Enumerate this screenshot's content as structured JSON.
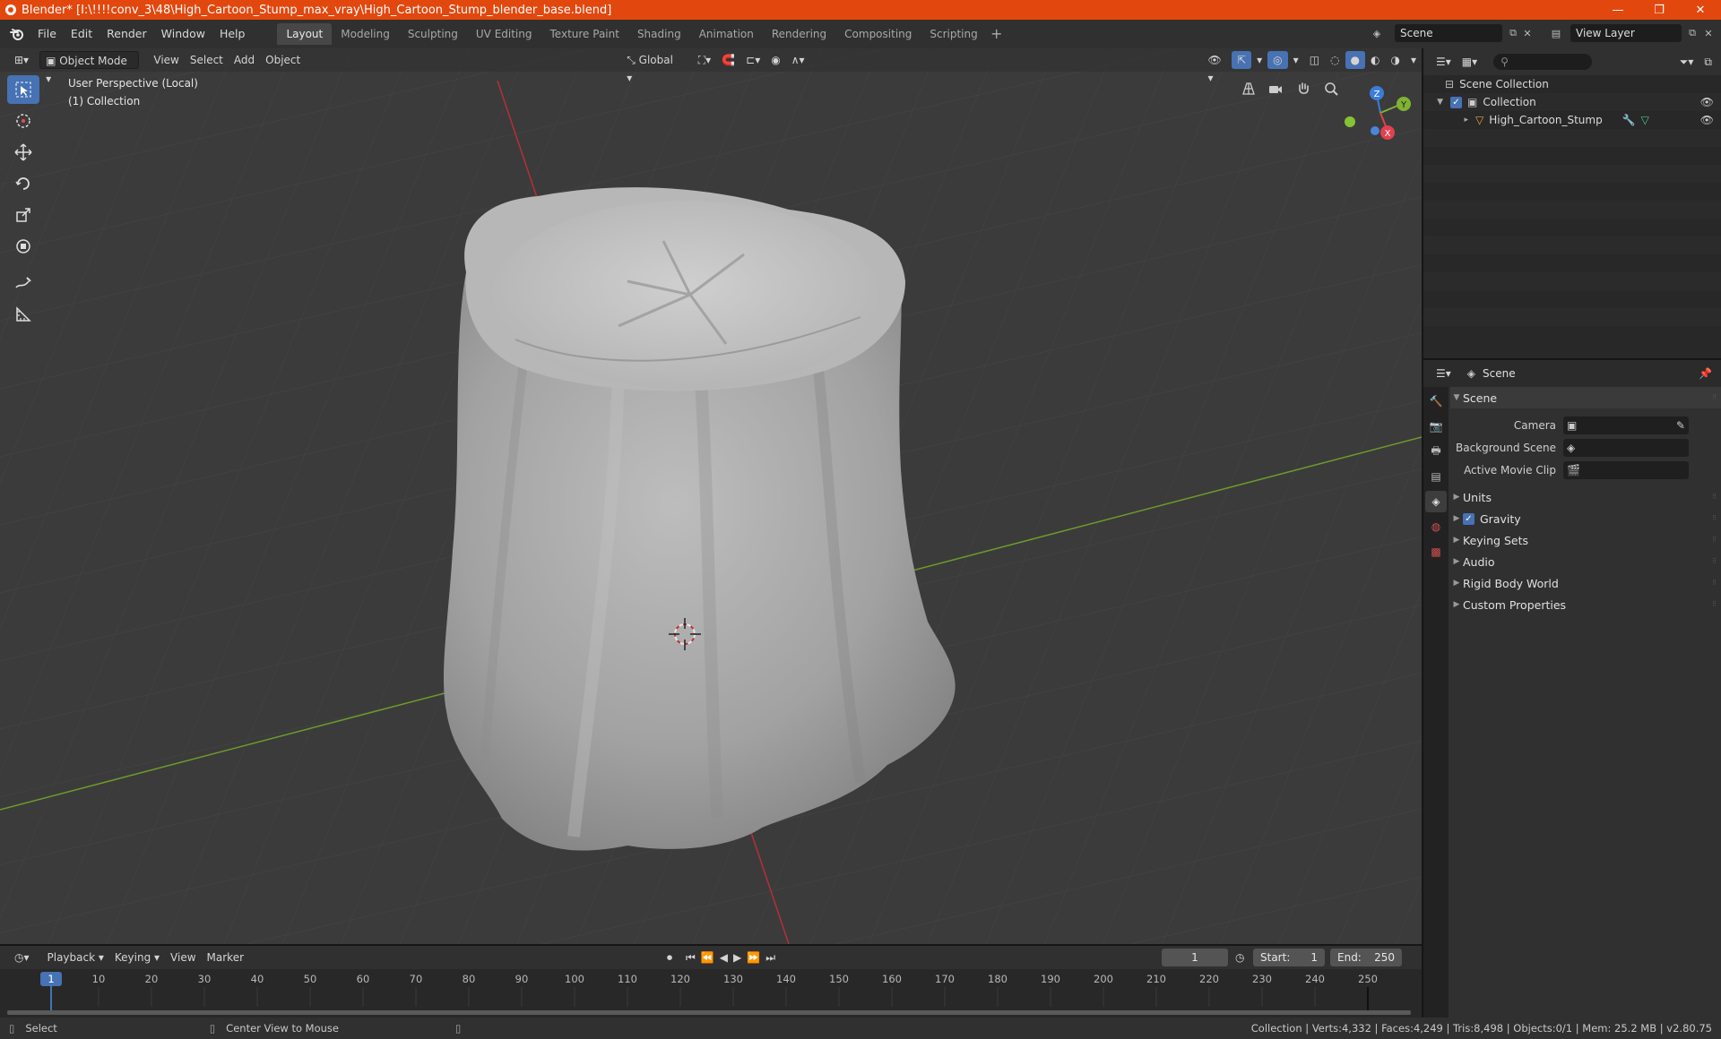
{
  "window": {
    "title": "Blender* [I:\\!!!!conv_3\\48\\High_Cartoon_Stump_max_vray\\High_Cartoon_Stump_blender_base.blend]",
    "minimize": "—",
    "maximize": "❐",
    "close": "✕"
  },
  "menu": [
    "File",
    "Edit",
    "Render",
    "Window",
    "Help"
  ],
  "workspaces": [
    "Layout",
    "Modeling",
    "Sculpting",
    "UV Editing",
    "Texture Paint",
    "Shading",
    "Animation",
    "Rendering",
    "Compositing",
    "Scripting"
  ],
  "active_workspace": "Layout",
  "scene_name": "Scene",
  "view_layer": "View Layer",
  "viewport": {
    "mode": "Object Mode",
    "menus": [
      "View",
      "Select",
      "Add",
      "Object"
    ],
    "transform_orientation": "Global",
    "perspective_label": "User Perspective (Local)",
    "collection_label": "(1) Collection",
    "gizmo_axes": {
      "z": "Z",
      "y": "Y",
      "x": "X"
    }
  },
  "outliner": {
    "rows": [
      {
        "label": "Scene Collection",
        "indent": 0
      },
      {
        "label": "Collection",
        "indent": 1
      },
      {
        "label": "High_Cartoon_Stump",
        "indent": 2
      }
    ]
  },
  "properties": {
    "context": "Scene",
    "section": "Scene",
    "fields": [
      {
        "label": "Camera"
      },
      {
        "label": "Background Scene"
      },
      {
        "label": "Active Movie Clip"
      }
    ],
    "panels": [
      "Units",
      "Gravity",
      "Keying Sets",
      "Audio",
      "Rigid Body World",
      "Custom Properties"
    ]
  },
  "timeline": {
    "menus": [
      "Playback",
      "Keying",
      "View",
      "Marker"
    ],
    "current_frame": "1",
    "start_label": "Start:",
    "start": "1",
    "end_label": "End:",
    "end": "250",
    "ticks": [
      "1",
      "10",
      "20",
      "30",
      "40",
      "50",
      "60",
      "70",
      "80",
      "90",
      "100",
      "110",
      "120",
      "130",
      "140",
      "150",
      "160",
      "170",
      "180",
      "190",
      "200",
      "210",
      "220",
      "230",
      "240",
      "250"
    ]
  },
  "status": {
    "left": "Select",
    "middle": "Center View to Mouse",
    "right": "Collection | Verts:4,332 | Faces:4,249 | Tris:8,498 | Objects:0/1 | Mem: 25.2 MB | v2.80.75"
  },
  "colors": {
    "title_bar": "#e2470e",
    "accent": "#4772b3",
    "viewport_bg": "#3d3d3d",
    "mesh": "#a9a9a9",
    "axis_x": "#b3303a",
    "axis_y": "#6e9a2a"
  }
}
